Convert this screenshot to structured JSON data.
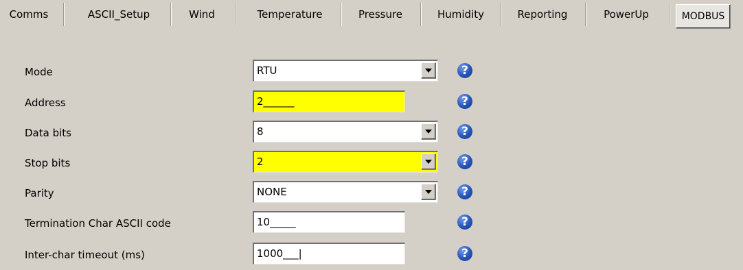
{
  "tabs": [
    {
      "label": "Comms"
    },
    {
      "label": "ASCII_Setup"
    },
    {
      "label": "Wind"
    },
    {
      "label": "Temperature"
    },
    {
      "label": "Pressure"
    },
    {
      "label": "Humidity"
    },
    {
      "label": "Reporting"
    },
    {
      "label": "PowerUp"
    },
    {
      "label": "MODBUS",
      "active": true
    }
  ],
  "fields": [
    {
      "label": "Mode",
      "type": "select",
      "value": "RTU",
      "highlight": false
    },
    {
      "label": "Address",
      "type": "input",
      "value": "2______",
      "highlight": true
    },
    {
      "label": "Data bits",
      "type": "select",
      "value": "8",
      "highlight": false
    },
    {
      "label": "Stop bits",
      "type": "select",
      "value": "2",
      "highlight": true
    },
    {
      "label": "Parity",
      "type": "select",
      "value": "NONE",
      "highlight": false
    },
    {
      "label": "Termination Char ASCII code",
      "type": "input",
      "value": "10_____",
      "highlight": false
    },
    {
      "label": "Inter-char timeout (ms)",
      "type": "input",
      "value": "1000___|",
      "highlight": false
    }
  ],
  "help_icon": {
    "glyph": "?",
    "name": "help-icon",
    "color": "#2553b8"
  },
  "colors": {
    "background": "#d4d0c8",
    "highlight": "#ffff00"
  }
}
